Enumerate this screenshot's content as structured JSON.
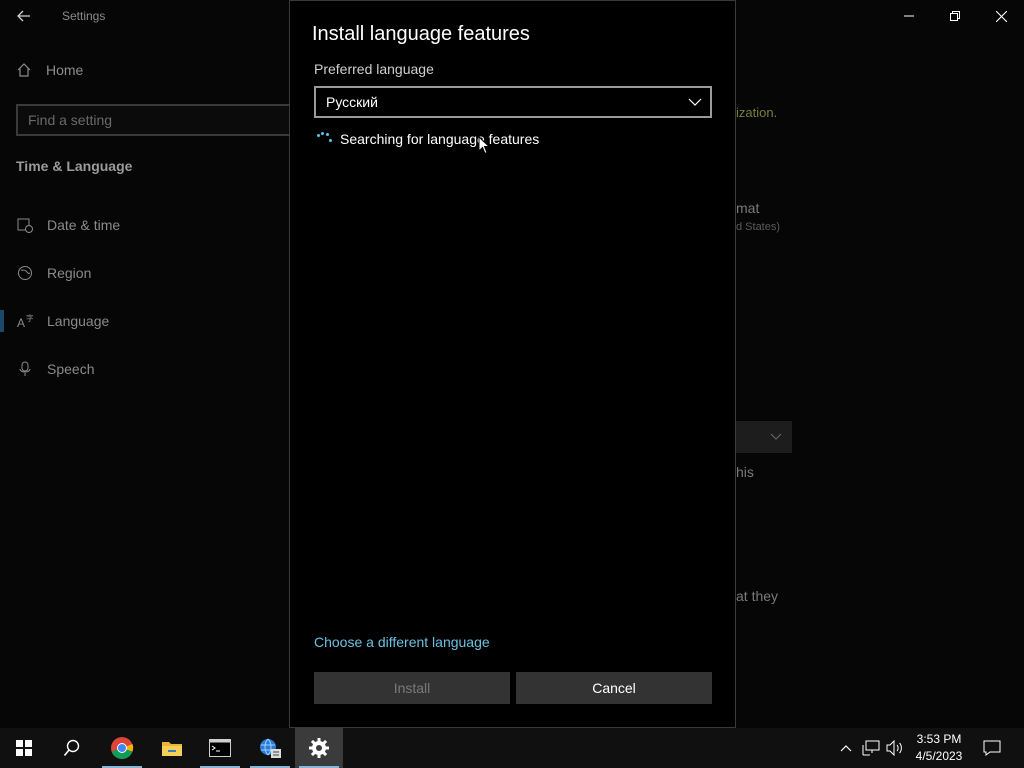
{
  "window": {
    "title": "Settings"
  },
  "sidebar": {
    "home_label": "Home",
    "search_placeholder": "Find a setting",
    "section_title": "Time & Language",
    "items": [
      {
        "label": "Date & time",
        "icon": "date-time-icon"
      },
      {
        "label": "Region",
        "icon": "region-icon"
      },
      {
        "label": "Language",
        "icon": "language-icon",
        "selected": true
      },
      {
        "label": "Speech",
        "icon": "microphone-icon"
      }
    ]
  },
  "background_fragments": {
    "link_text": "ization.",
    "format_text": "mat",
    "format_sub": "d States)",
    "text_this": "his",
    "text_they": "at they"
  },
  "dialog": {
    "title": "Install language features",
    "preferred_label": "Preferred language",
    "selected_language": "Русский",
    "status_text": "Searching for language features",
    "choose_link": "Choose a different language",
    "install_button": "Install",
    "cancel_button": "Cancel"
  },
  "taskbar": {
    "apps": [
      "start",
      "search",
      "chrome",
      "file-explorer",
      "command-prompt",
      "network-app",
      "settings"
    ],
    "active_app": "settings",
    "time": "3:53 PM",
    "date": "4/5/2023"
  },
  "colors": {
    "accent_link": "#6bc1e0",
    "spinner": "#5dc2e8",
    "dialog_bg": "#000000",
    "button_bg": "#333333"
  }
}
